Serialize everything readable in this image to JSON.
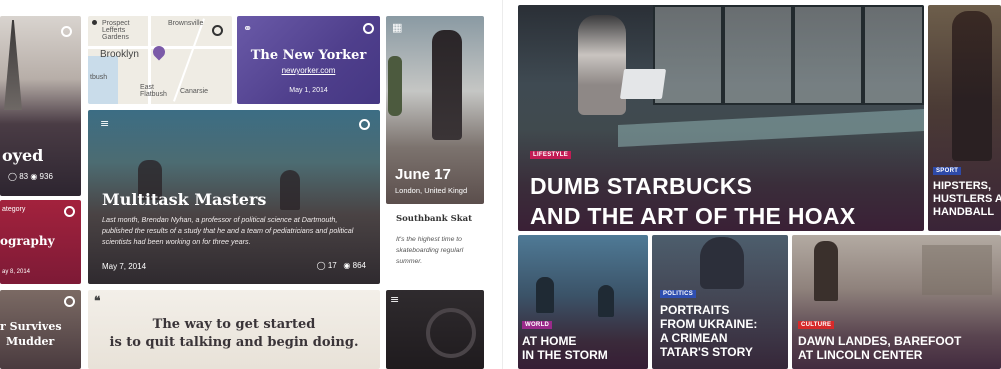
{
  "left": {
    "eiffel": {
      "partial_title": "oyed",
      "comments": "83",
      "views": "936"
    },
    "map": {
      "labels": [
        "Prospect",
        "Lefferts",
        "Gardens",
        "Brownsville",
        "Brooklyn",
        "East",
        "Flatbush",
        "Canarsie",
        "tbush"
      ]
    },
    "newyorker": {
      "title": "The New Yorker",
      "url": "newyorker.com",
      "date": "May 1, 2014"
    },
    "multitask": {
      "title": "Multitask Masters",
      "body": "Last month, Brendan Nyhan, a professor of political science at Dartmouth, published the results of a study that he and a team of pediatricians and political scientists had been working on for three years.",
      "date": "May 7, 2014",
      "comments": "17",
      "views": "864"
    },
    "skater": {
      "title": "June 17",
      "place": "London, United Kingd"
    },
    "southbank": {
      "title": "Southbank Skat",
      "body": "It's the highest time to skateboarding regularl summer."
    },
    "infographic": {
      "category": "ategory",
      "title": "ography",
      "date": "ay 8, 2014"
    },
    "mudder": {
      "line1": "r Survives",
      "line2": "Mudder"
    },
    "quote": {
      "mark": "❝",
      "line1": "The way to get started",
      "line2": "is to quit talking and begin doing."
    }
  },
  "right": {
    "hero": {
      "tag": "LIFESTYLE",
      "line1": "DUMB STARBUCKS",
      "line2": "AND THE ART OF THE HOAX"
    },
    "hipsters": {
      "tag": "SPORT",
      "line1": "HIPSTERS,",
      "line2": "HUSTLERS A",
      "line3": "HANDBALL"
    },
    "storm": {
      "tag": "WORLD",
      "line1": "AT HOME",
      "line2": "IN THE STORM"
    },
    "ukraine": {
      "tag": "POLITICS",
      "line1": "PORTRAITS",
      "line2": "FROM UKRAINE:",
      "line3": "A CRIMEAN",
      "line4": "TATAR'S STORY"
    },
    "lincoln": {
      "tag": "CULTURE",
      "line1": "DAWN LANDES, BAREFOOT",
      "line2": "AT LINCOLN CENTER"
    }
  },
  "colors": {
    "tag_lifestyle": "#c21c54",
    "tag_sport": "#2e4aa8",
    "tag_world": "#9a2a8a",
    "tag_politics": "#2f4fb0",
    "tag_culture": "#d62a2a",
    "newyorker_purple": "#4f3f8c",
    "infographic_red": "#a3223d"
  }
}
